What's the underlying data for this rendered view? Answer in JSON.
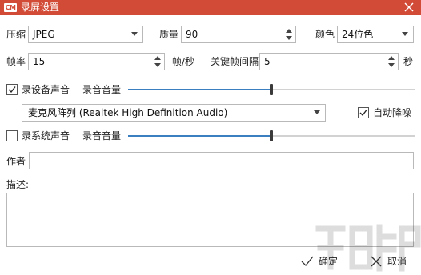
{
  "window": {
    "logo_text": "CM",
    "title": "录屏设置"
  },
  "row1": {
    "compress_label": "压缩",
    "compress_value": "JPEG",
    "quality_label": "质量",
    "quality_value": "90",
    "color_label": "颜色",
    "color_value": "24位色"
  },
  "row2": {
    "fps_label": "帧率",
    "fps_value": "15",
    "fps_unit": "帧/秒",
    "keyframe_label": "关键帧间隔",
    "keyframe_value": "5",
    "keyframe_unit": "秒"
  },
  "device_audio": {
    "checkbox_label": "录设备声音",
    "checked": true,
    "volume_label": "录音音量",
    "volume_level": 0.5,
    "device_value": "麦克风阵列 (Realtek High Definition Audio)",
    "noise_reduction_label": "自动降噪",
    "noise_reduction_checked": true
  },
  "system_audio": {
    "checkbox_label": "录系统声音",
    "checked": false,
    "volume_label": "录音音量",
    "volume_level": 0.5
  },
  "author": {
    "label": "作者",
    "value": ""
  },
  "description": {
    "label": "描述:",
    "value": ""
  },
  "footer": {
    "ok_label": "确定",
    "cancel_label": "取消"
  },
  "colors": {
    "titlebar": "#d24b37",
    "slider_fill": "#3c7fc1"
  }
}
